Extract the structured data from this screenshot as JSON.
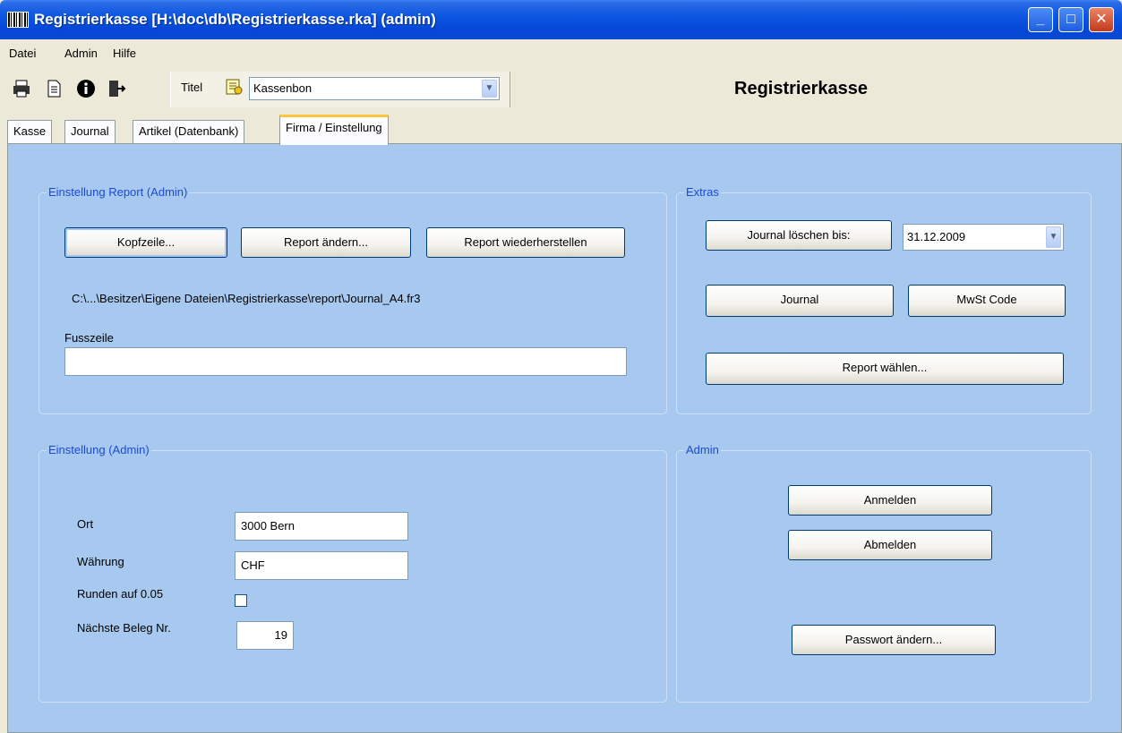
{
  "window": {
    "title": "Registrierkasse [H:\\doc\\db\\Registrierkasse.rka] (admin)",
    "minimize_glyph": "_",
    "maximize_glyph": "□",
    "close_glyph": "✕"
  },
  "menu": {
    "items": [
      "Datei",
      "Admin",
      "Hilfe"
    ]
  },
  "toolbar": {
    "icons": [
      "printer-icon",
      "document-icon",
      "info-icon",
      "exit-door-icon"
    ],
    "title_label": "Titel",
    "title_value": "Kassenbon",
    "heading": "Registrierkasse"
  },
  "tabs": [
    {
      "label": "Kasse",
      "active": false
    },
    {
      "label": "Journal",
      "active": false
    },
    {
      "label": "Artikel (Datenbank)",
      "active": false
    },
    {
      "label": "Firma / Einstellung",
      "active": true
    }
  ],
  "report_group": {
    "title": "Einstellung Report (Admin)",
    "kopfzeile_button": "Kopfzeile...",
    "report_aendern_button": "Report ändern...",
    "report_wiederherstellen_button": "Report wiederherstellen",
    "report_path": "C:\\...\\Besitzer\\Eigene Dateien\\Registrierkasse\\report\\Journal_A4.fr3",
    "fusszeile_label": "Fusszeile",
    "fusszeile_value": ""
  },
  "extras_group": {
    "title": "Extras",
    "journal_loeschen_button": "Journal löschen bis:",
    "journal_date": "31.12.2009",
    "journal_button": "Journal",
    "mwst_button": "MwSt Code",
    "report_waehlen_button": "Report wählen..."
  },
  "settings_group": {
    "title": "Einstellung (Admin)",
    "ort_label": "Ort",
    "ort_value": "3000 Bern",
    "waehrung_label": "Währung",
    "waehrung_value": "CHF",
    "runden_label": "Runden auf 0.05",
    "runden_checked": false,
    "beleg_label": "Nächste Beleg Nr.",
    "beleg_value": "19"
  },
  "admin_group": {
    "title": "Admin",
    "anmelden_button": "Anmelden",
    "abmelden_button": "Abmelden",
    "passwort_button": "Passwort ändern..."
  },
  "colors": {
    "panel_bg": "#a7c9ef",
    "group_title": "#1c4bd1",
    "titlebar": "#0a54e0"
  }
}
